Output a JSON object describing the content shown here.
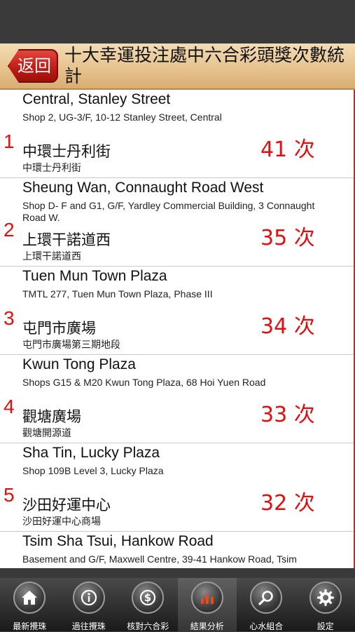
{
  "header": {
    "back_label": "返回",
    "title": "十大幸運投注處中六合彩頭獎次數統計"
  },
  "items": [
    {
      "rank": "1",
      "en_name": "Central, Stanley Street",
      "en_addr": "Shop 2, UG-3/F, 10-12 Stanley Street, Central",
      "zh_name": "中環士丹利街",
      "zh_addr": "中環士丹利街",
      "count": "41 次"
    },
    {
      "rank": "2",
      "en_name": "Sheung Wan, Connaught Road West",
      "en_addr": "Shop D- F and G1, G/F, Yardley Commercial Building, 3 Connaught Road W.",
      "zh_name": "上環干諾道西",
      "zh_addr": "上環干諾道西",
      "count": "35 次"
    },
    {
      "rank": "3",
      "en_name": "Tuen Mun Town Plaza",
      "en_addr": "TMTL 277, Tuen Mun Town Plaza, Phase III",
      "zh_name": "屯門市廣場",
      "zh_addr": "屯門市廣場第三期地段",
      "count": "34 次"
    },
    {
      "rank": "4",
      "en_name": "Kwun Tong Plaza",
      "en_addr": "Shops G15 & M20 Kwun Tong Plaza, 68 Hoi Yuen Road",
      "zh_name": "觀塘廣場",
      "zh_addr": "觀塘開源道",
      "count": "33 次"
    },
    {
      "rank": "5",
      "en_name": "Sha Tin, Lucky Plaza",
      "en_addr": "Shop 109B Level 3, Lucky Plaza",
      "zh_name": "沙田好運中心",
      "zh_addr": "沙田好運中心商場",
      "count": "32 次"
    },
    {
      "rank": "",
      "en_name": "Tsim Sha Tsui, Hankow Road",
      "en_addr": "Basement and G/F, Maxwell Centre, 39-41 Hankow Road, Tsim",
      "zh_name": "",
      "zh_addr": "",
      "count": ""
    }
  ],
  "tabs": [
    {
      "label": "最新攪珠",
      "icon": "home-icon"
    },
    {
      "label": "過往攪珠",
      "icon": "info-icon"
    },
    {
      "label": "核對六合彩",
      "icon": "dollar-icon"
    },
    {
      "label": "結果分析",
      "icon": "bar-chart-icon"
    },
    {
      "label": "心水組合",
      "icon": "search-icon"
    },
    {
      "label": "設定",
      "icon": "gear-icon"
    }
  ],
  "colors": {
    "accent": "#e01010",
    "header_wood": "#e6c38e",
    "back_button": "#c01d16"
  }
}
